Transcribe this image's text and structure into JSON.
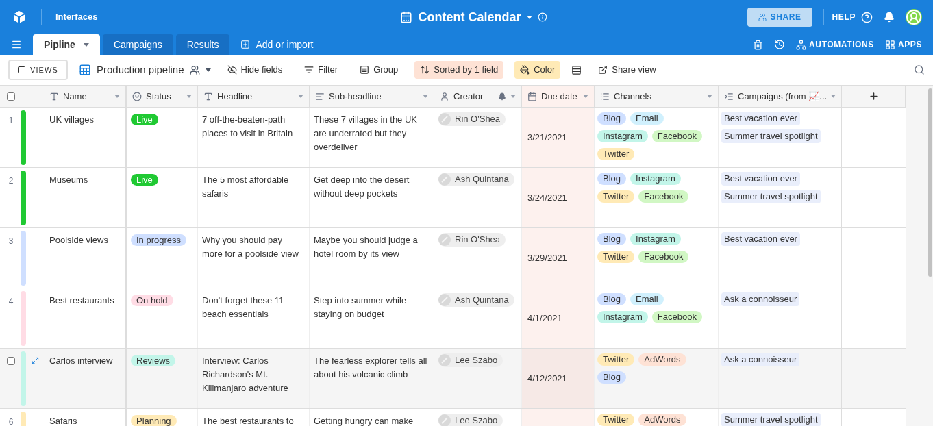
{
  "topbar": {
    "section": "Interfaces",
    "title": "Content Calendar",
    "share": "SHARE",
    "help": "HELP"
  },
  "tabs": [
    {
      "label": "Pipline",
      "selected": true
    },
    {
      "label": "Campaigns",
      "selected": false
    },
    {
      "label": "Results",
      "selected": false
    }
  ],
  "add_tab": "Add or import",
  "top_actions": {
    "automations": "AUTOMATIONS",
    "apps": "APPS"
  },
  "toolbar": {
    "views": "VIEWS",
    "view_name": "Production pipeline",
    "hide_fields": "Hide fields",
    "filter": "Filter",
    "group": "Group",
    "sort": "Sorted by 1 field",
    "color_button": "Color",
    "share_view": "Share view"
  },
  "select_all": {
    "checked": false
  },
  "columns": [
    "Name",
    "Status",
    "Headline",
    "Sub-headline",
    "Creator",
    "Due date",
    "Channels",
    "Campaigns (from 📈..."
  ],
  "rows": [
    {
      "number": "1",
      "hovered": false,
      "color": "#20c933",
      "name": "UK villages",
      "status": {
        "label": "Live",
        "color": "#20c933"
      },
      "headline": "7 off-the-beaten-path places to visit in Britain",
      "subheadline": "These 7 villages in the UK are underrated but they overdeliver",
      "creator": "Rin O'Shea",
      "due": "3/21/2021",
      "channels": [
        {
          "label": "Blog",
          "color": "#cfdfff"
        },
        {
          "label": "Email",
          "color": "#d0f0fd"
        },
        {
          "label": "Instagram",
          "color": "#c2f5e9"
        },
        {
          "label": "Facebook",
          "color": "#d1f7c4"
        },
        {
          "label": "Twitter",
          "color": "#ffeab6"
        }
      ],
      "campaigns": [
        "Best vacation ever",
        "Summer travel spotlight"
      ]
    },
    {
      "number": "2",
      "hovered": false,
      "color": "#20c933",
      "name": "Museums",
      "status": {
        "label": "Live",
        "color": "#20c933"
      },
      "headline": "The 5 most affordable safaris",
      "subheadline": "Get deep into the desert without deep pockets",
      "creator": "Ash Quintana",
      "due": "3/24/2021",
      "channels": [
        {
          "label": "Blog",
          "color": "#cfdfff"
        },
        {
          "label": "Instagram",
          "color": "#c2f5e9"
        },
        {
          "label": "Twitter",
          "color": "#ffeab6"
        },
        {
          "label": "Facebook",
          "color": "#d1f7c4"
        }
      ],
      "campaigns": [
        "Best vacation ever",
        "Summer travel spotlight"
      ]
    },
    {
      "number": "3",
      "hovered": false,
      "color": "#cfdfff",
      "name": "Poolside views",
      "status": {
        "label": "In progress",
        "color": "#cfdfff"
      },
      "headline": "Why you should pay more for a poolside view",
      "subheadline": "Maybe you should judge a hotel room by its view",
      "creator": "Rin O'Shea",
      "due": "3/29/2021",
      "channels": [
        {
          "label": "Blog",
          "color": "#cfdfff"
        },
        {
          "label": "Instagram",
          "color": "#c2f5e9"
        },
        {
          "label": "Twitter",
          "color": "#ffeab6"
        },
        {
          "label": "Facebook",
          "color": "#d1f7c4"
        }
      ],
      "campaigns": [
        "Best vacation ever"
      ]
    },
    {
      "number": "4",
      "hovered": false,
      "color": "#ffdce5",
      "name": "Best restaurants",
      "status": {
        "label": "On hold",
        "color": "#ffdce5"
      },
      "headline": "Don't forget these 11 beach essentials",
      "subheadline": "Step into summer while staying on budget",
      "creator": "Ash Quintana",
      "due": "4/1/2021",
      "channels": [
        {
          "label": "Blog",
          "color": "#cfdfff"
        },
        {
          "label": "Email",
          "color": "#d0f0fd"
        },
        {
          "label": "Instagram",
          "color": "#c2f5e9"
        },
        {
          "label": "Facebook",
          "color": "#d1f7c4"
        }
      ],
      "campaigns": [
        "Ask a connoisseur"
      ]
    },
    {
      "hovered": true,
      "checked": false,
      "color": "#c2f5e9",
      "name": "Carlos interview",
      "status": {
        "label": "Reviews",
        "color": "#c2f5e9"
      },
      "headline": "Interview: Carlos Richardson's Mt. Kilimanjaro adventure",
      "subheadline": "The fearless explorer tells all about his volcanic climb",
      "creator": "Lee Szabo",
      "due": "4/12/2021",
      "channels": [
        {
          "label": "Twitter",
          "color": "#ffeab6"
        },
        {
          "label": "AdWords",
          "color": "#fee2d5"
        },
        {
          "label": "Blog",
          "color": "#cfdfff"
        }
      ],
      "campaigns": [
        "Ask a connoisseur"
      ]
    },
    {
      "number": "6",
      "hovered": false,
      "color": "#ffeab6",
      "name": "Safaris",
      "status": {
        "label": "Planning",
        "color": "#ffeab6"
      },
      "headline": "The best restaurants to",
      "subheadline": "Getting hungry can make",
      "creator": "Lee Szabo",
      "channels": [
        {
          "label": "Twitter",
          "color": "#ffeab6"
        },
        {
          "label": "AdWords",
          "color": "#fee2d5"
        }
      ],
      "campaigns": [
        "Summer travel spotlight"
      ]
    }
  ]
}
